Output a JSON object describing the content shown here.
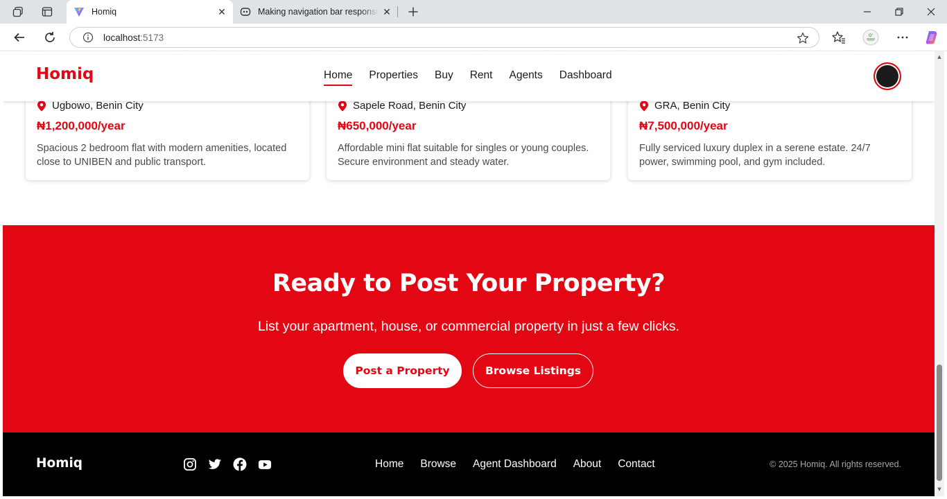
{
  "browser": {
    "tabs": [
      {
        "title": "Homiq",
        "close_icon": "✕",
        "favicon": "vite-icon"
      },
      {
        "title": "Making navigation bar responsive",
        "close_icon": "✕",
        "favicon": "copilot-icon"
      }
    ],
    "url_host": "localhost",
    "url_port": ":5173"
  },
  "nav": {
    "logo": "Homiq",
    "links": [
      "Home",
      "Properties",
      "Buy",
      "Rent",
      "Agents",
      "Dashboard"
    ],
    "active": "Home"
  },
  "listings": [
    {
      "location": "Ugbowo, Benin City",
      "price": "₦1,200,000/year",
      "description": "Spacious 2 bedroom flat with modern amenities, located close to UNIBEN and public transport."
    },
    {
      "location": "Sapele Road, Benin City",
      "price": "₦650,000/year",
      "description": "Affordable mini flat suitable for singles or young couples. Secure environment and steady water."
    },
    {
      "location": "GRA, Benin City",
      "price": "₦7,500,000/year",
      "description": "Fully serviced luxury duplex in a serene estate. 24/7 power, swimming pool, and gym included."
    }
  ],
  "cta": {
    "heading": "Ready to Post Your Property?",
    "subtext": "List your apartment, house, or commercial property in just a few clicks.",
    "primary_button": "Post a Property",
    "secondary_button": "Browse Listings"
  },
  "footer": {
    "logo": "Homiq",
    "social_icons": [
      "instagram-icon",
      "twitter-icon",
      "facebook-icon",
      "youtube-icon"
    ],
    "links": [
      "Home",
      "Browse",
      "Agent Dashboard",
      "About",
      "Contact"
    ],
    "copyright": "© 2025 Homiq. All rights reserved."
  },
  "colors": {
    "brand_red": "#e30613",
    "footer_bg": "#000000",
    "text_dark": "#1a1a1a"
  }
}
